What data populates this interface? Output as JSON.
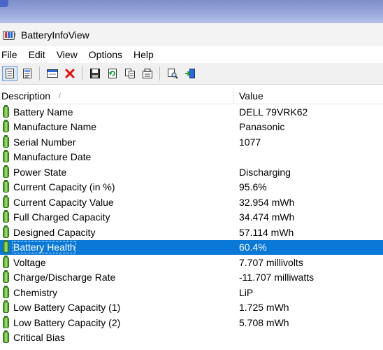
{
  "window": {
    "title": "BatteryInfoView"
  },
  "menu": [
    "File",
    "Edit",
    "View",
    "Options",
    "Help"
  ],
  "toolbar": {
    "buttons": [
      "properties-icon",
      "html-report-icon",
      "window-icon",
      "delete-icon",
      "save-icon",
      "refresh-icon",
      "copy-icon",
      "options-icon",
      "find-icon",
      "exit-icon"
    ]
  },
  "columns": {
    "description": "Description",
    "value": "Value"
  },
  "rows": [
    {
      "description": "Battery Name",
      "value": "DELL 79VRK62"
    },
    {
      "description": "Manufacture Name",
      "value": "Panasonic"
    },
    {
      "description": "Serial Number",
      "value": "1077"
    },
    {
      "description": "Manufacture Date",
      "value": ""
    },
    {
      "description": "Power State",
      "value": "Discharging"
    },
    {
      "description": "Current Capacity (in %)",
      "value": "95.6%"
    },
    {
      "description": "Current Capacity Value",
      "value": "32.954 mWh"
    },
    {
      "description": "Full Charged Capacity",
      "value": "34.474 mWh"
    },
    {
      "description": "Designed Capacity",
      "value": "57.114 mWh"
    },
    {
      "description": "Battery Health",
      "value": "60.4%"
    },
    {
      "description": "Voltage",
      "value": "7.707 millivolts"
    },
    {
      "description": "Charge/Discharge Rate",
      "value": "-11.707 milliwatts"
    },
    {
      "description": "Chemistry",
      "value": "LiP"
    },
    {
      "description": "Low Battery Capacity (1)",
      "value": "1.725 mWh"
    },
    {
      "description": "Low Battery Capacity (2)",
      "value": "5.708 mWh"
    },
    {
      "description": "Critical Bias",
      "value": ""
    }
  ],
  "selected_row": "Battery Health",
  "colors": {
    "selection": "#0a78d7",
    "battery_green": "#4ea329"
  }
}
